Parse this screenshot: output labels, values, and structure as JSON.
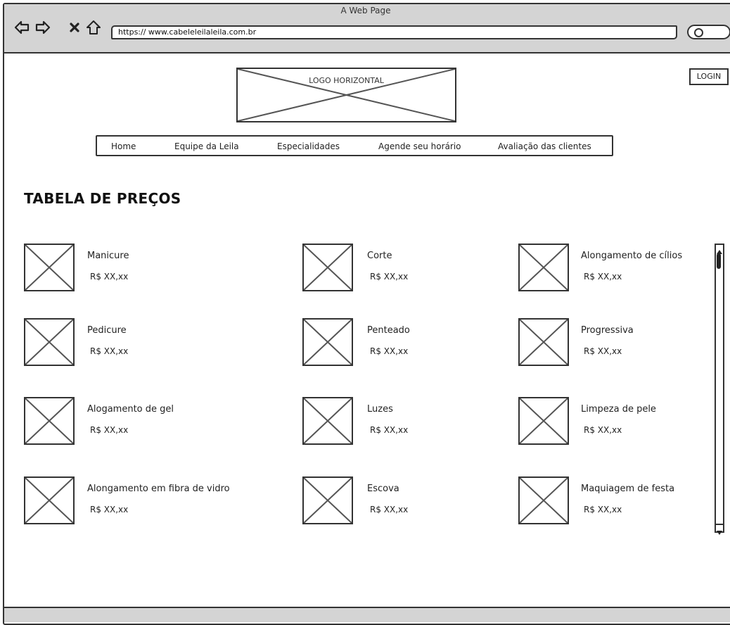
{
  "window": {
    "title": "A Web Page"
  },
  "browser": {
    "url": "https://  www.cabeleleilaleila.com.br"
  },
  "header": {
    "logo_text": "LOGO HORIZONTAL",
    "login_label": "LOGIN"
  },
  "nav": {
    "items": [
      {
        "label": "Home"
      },
      {
        "label": "Equipe da Leila"
      },
      {
        "label": "Especialidades"
      },
      {
        "label": "Agende seu horário"
      },
      {
        "label": "Avaliação das clientes"
      }
    ]
  },
  "main": {
    "title": "TABELA DE PREÇOS",
    "services": [
      {
        "name": "Manicure",
        "price": "R$ XX,xx"
      },
      {
        "name": "Corte",
        "price": "R$ XX,xx"
      },
      {
        "name": "Alongamento de cílios",
        "price": "R$ XX,xx"
      },
      {
        "name": "Pedicure",
        "price": "R$ XX,xx"
      },
      {
        "name": "Penteado",
        "price": "R$ XX,xx"
      },
      {
        "name": "Progressiva",
        "price": "R$ XX,xx"
      },
      {
        "name": "Alogamento de gel",
        "price": "R$ XX,xx"
      },
      {
        "name": "Luzes",
        "price": "R$ XX,xx"
      },
      {
        "name": "Limpeza de pele",
        "price": "R$ XX,xx"
      },
      {
        "name": "Alongamento em fibra de vidro",
        "price": "R$ XX,xx"
      },
      {
        "name": "Escova",
        "price": "R$ XX,xx"
      },
      {
        "name": "Maquiagem de festa",
        "price": "R$ XX,xx"
      }
    ]
  },
  "icons": {
    "back": "back-arrow-icon",
    "forward": "forward-arrow-icon",
    "stop": "close-icon",
    "home": "home-icon",
    "search": "search-icon",
    "image_placeholder": "image-placeholder-icon"
  },
  "colors": {
    "chrome": "#d4d4d4",
    "stroke": "#333333",
    "background": "#ffffff"
  }
}
